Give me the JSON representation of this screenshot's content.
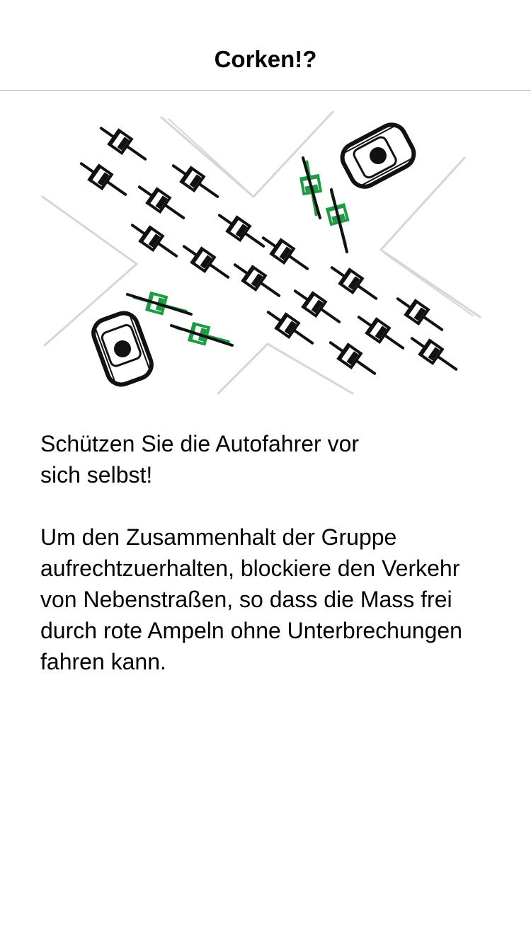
{
  "nav": {
    "title": "Corken!?"
  },
  "illustration": {
    "description_icon": "critical-mass-corking-illustration",
    "colors": {
      "cyclist": "#111111",
      "corker": "#1f9a45",
      "road": "#d6d6d6"
    }
  },
  "content": {
    "lead": "Schützen Sie die Autofahrer vor sich selbst!",
    "body": "Um den Zusammenhalt der Gruppe aufrechtzuerhalten, blockiere den Verkehr von Nebenstraßen, so dass die Mass frei durch rote Ampeln ohne Unterbrechungen fahren kann."
  }
}
